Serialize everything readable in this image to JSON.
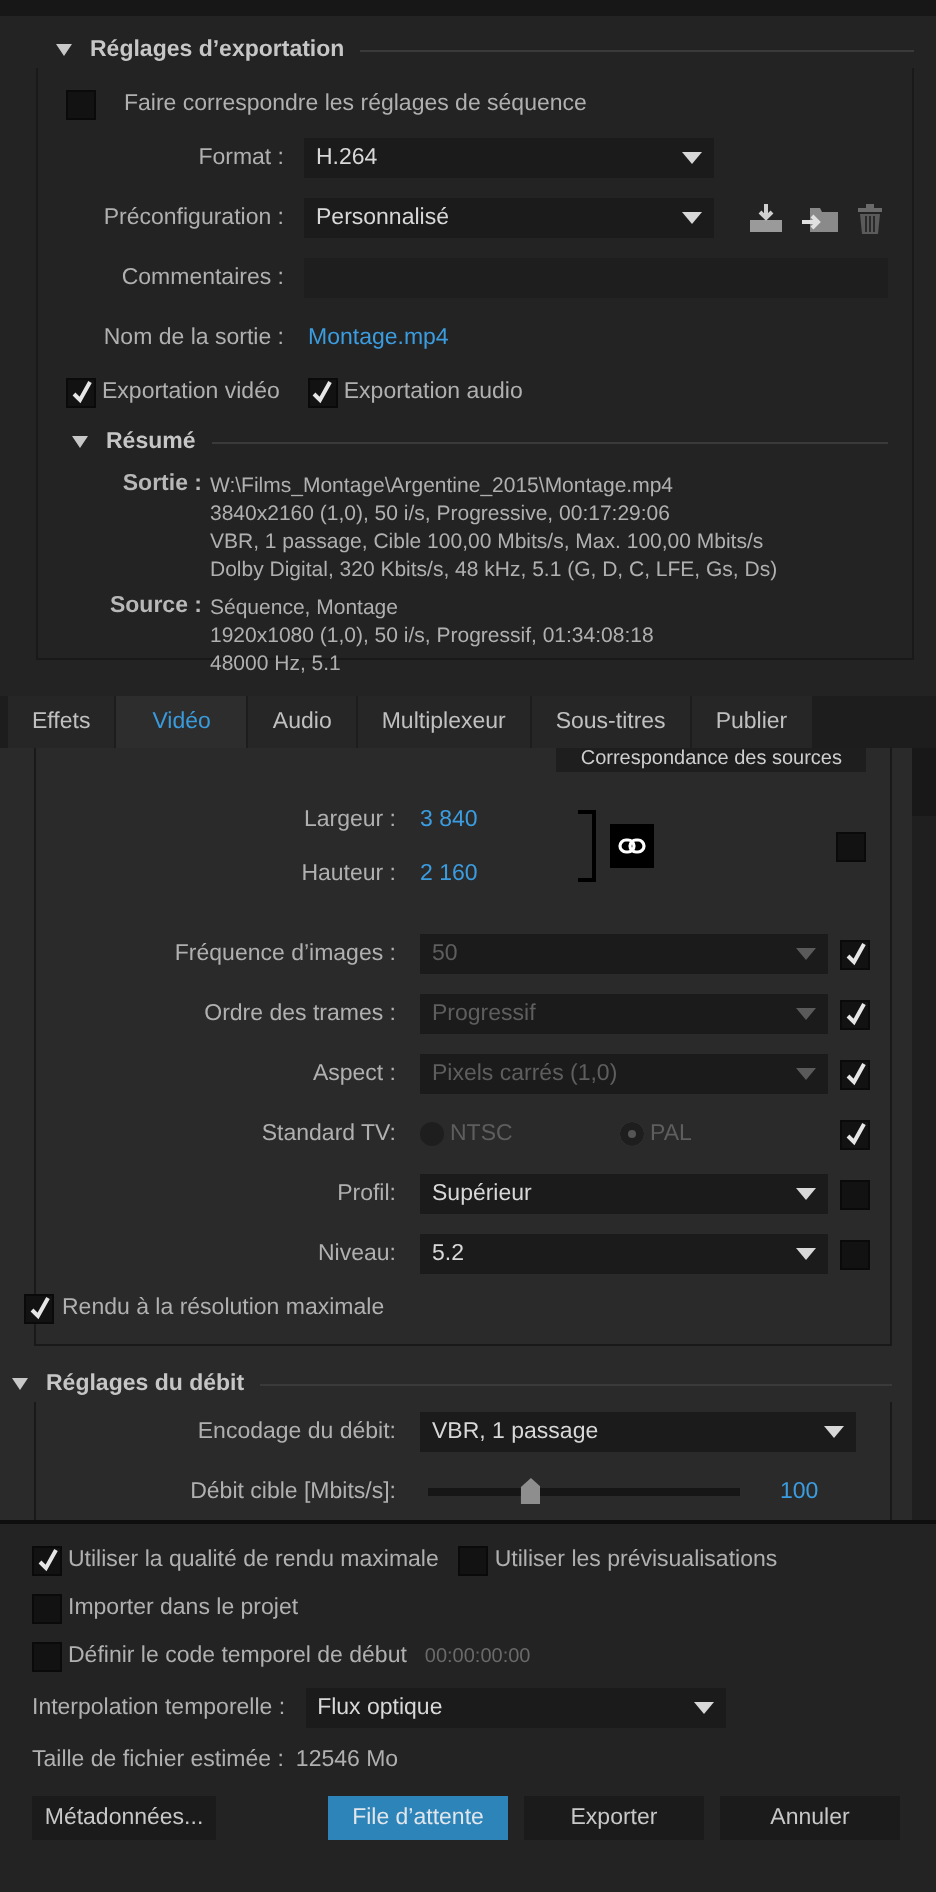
{
  "export_settings": {
    "title": "Réglages d’exportation",
    "expanded": true,
    "match_sequence": {
      "label": "Faire correspondre les réglages de séquence",
      "checked": false
    },
    "format": {
      "label": "Format :",
      "value": "H.264"
    },
    "preset": {
      "label": "Préconfiguration :",
      "value": "Personnalisé"
    },
    "comments": {
      "label": "Commentaires :"
    },
    "output_name": {
      "label": "Nom de la sortie :",
      "value": "Montage.mp4"
    },
    "exports": [
      {
        "label": "Exportation vidéo",
        "checked": true
      },
      {
        "label": "Exportation audio",
        "checked": true
      }
    ],
    "summary": {
      "title": "Résumé",
      "expanded": true,
      "groups": [
        {
          "label": "Sortie :",
          "lines": [
            "W:\\Films_Montage\\Argentine_2015\\Montage.mp4",
            "3840x2160 (1,0), 50 i/s, Progressive, 00:17:29:06",
            "VBR, 1 passage, Cible 100,00  Mbits/s, Max. 100,00  Mbits/s",
            "Dolby Digital, 320  Kbits/s, 48  kHz, 5.1 (G, D, C, LFE, Gs, Ds)"
          ]
        },
        {
          "label": "Source :",
          "lines": [
            "Séquence, Montage",
            "1920x1080 (1,0), 50  i/s, Progressif, 01:34:08:18",
            "48000 Hz, 5.1"
          ]
        }
      ]
    }
  },
  "tabs": [
    {
      "label": "Effets",
      "selected": false
    },
    {
      "label": "Vidéo",
      "selected": true
    },
    {
      "label": "Audio",
      "selected": false
    },
    {
      "label": "Multiplexeur",
      "selected": false
    },
    {
      "label": "Sous-titres",
      "selected": false
    },
    {
      "label": "Publier",
      "selected": false
    }
  ],
  "video": {
    "match_source_button": "Correspondance des sources",
    "width": {
      "label": "Largeur :",
      "value": "3 840"
    },
    "height": {
      "label": "Hauteur :",
      "value": "2 160"
    },
    "linked": true,
    "size_checked": false,
    "rows": [
      {
        "kind": "select",
        "label": "Fréquence d’images :",
        "value": "50",
        "disabled": true,
        "checked": true
      },
      {
        "kind": "select",
        "label": "Ordre des trames :",
        "value": "Progressif",
        "disabled": true,
        "checked": true
      },
      {
        "kind": "select",
        "label": "Aspect :",
        "value": "Pixels carrés (1,0)",
        "disabled": true,
        "checked": true
      },
      {
        "kind": "radio",
        "label": "Standard TV:",
        "options": [
          {
            "label": "NTSC",
            "selected": false
          },
          {
            "label": "PAL",
            "selected": true
          }
        ],
        "disabled": true,
        "checked": true
      },
      {
        "kind": "select",
        "label": "Profil:",
        "value": "Supérieur",
        "disabled": false,
        "checked": false
      },
      {
        "kind": "select",
        "label": "Niveau:",
        "value": "5.2",
        "disabled": false,
        "checked": false
      }
    ],
    "max_render": {
      "label": "Rendu à la résolution maximale",
      "checked": true
    }
  },
  "bitrate": {
    "title": "Réglages du débit",
    "expanded": true,
    "encoding": {
      "label": "Encodage du débit:",
      "value": "VBR, 1 passage"
    },
    "target": {
      "label": "Débit cible [Mbits/s]:",
      "level": 0.33,
      "reading": "100"
    }
  },
  "options": [
    {
      "label": "Utiliser la qualité de rendu maximale",
      "checked": true
    },
    {
      "label": "Utiliser les prévisualisations",
      "checked": false
    },
    {
      "label": "Importer dans le projet",
      "checked": false
    },
    {
      "label": "Définir le code temporel de début",
      "checked": false,
      "timecode": "00:00:00:00"
    }
  ],
  "interpolation": {
    "label": "Interpolation temporelle :",
    "value": "Flux optique"
  },
  "file_size": {
    "label": "Taille de fichier estimée :",
    "value": "12546 Mo"
  },
  "buttons": [
    {
      "label": "Métadonnées...",
      "primary": false
    },
    {
      "label": "File d’attente",
      "primary": true
    },
    {
      "label": "Exporter",
      "primary": false
    },
    {
      "label": "Annuler",
      "primary": false
    }
  ]
}
